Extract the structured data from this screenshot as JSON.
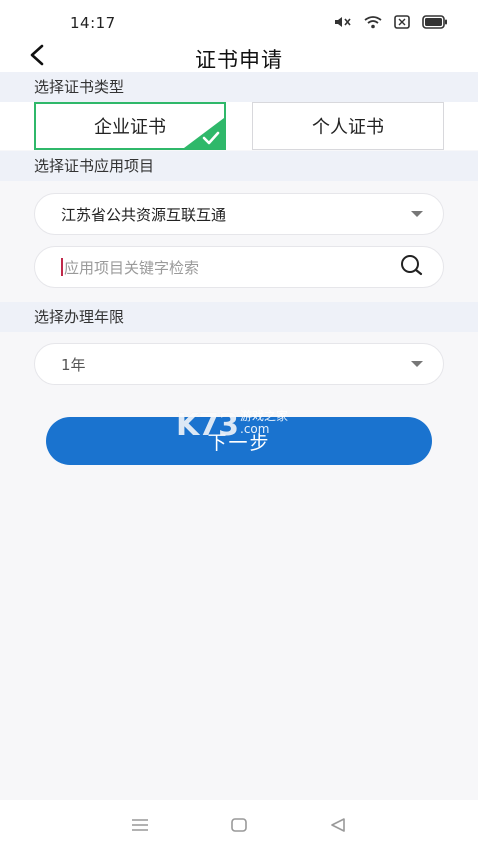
{
  "status_bar": {
    "time": "14:17",
    "icons": [
      "mute-icon",
      "wifi-icon",
      "sim-icon",
      "battery-icon"
    ]
  },
  "nav": {
    "title": "证书申请",
    "back_icon": "chevron-left-icon"
  },
  "cert_type": {
    "section_label": "选择证书类型",
    "options": [
      {
        "label": "企业证书",
        "selected": true
      },
      {
        "label": "个人证书",
        "selected": false
      }
    ],
    "check_icon": "check-icon"
  },
  "project": {
    "section_label": "选择证书应用项目",
    "selected_value": "江苏省公共资源互联互通",
    "search_placeholder": "应用项目关键字检索",
    "search_icon": "search-icon"
  },
  "duration": {
    "section_label": "选择办理年限",
    "selected_value": "1年"
  },
  "next_button": {
    "label": "下一步"
  },
  "watermark": {
    "logo": "K73",
    "line1": "游戏之家",
    "line2": ".com"
  },
  "colors": {
    "accent": "#1a73cf",
    "selected_border": "#2fb86a",
    "section_bg": "#eef1f8"
  },
  "bottom_nav": {
    "icons": [
      "menu-icon",
      "home-icon",
      "back-triangle-icon"
    ]
  }
}
